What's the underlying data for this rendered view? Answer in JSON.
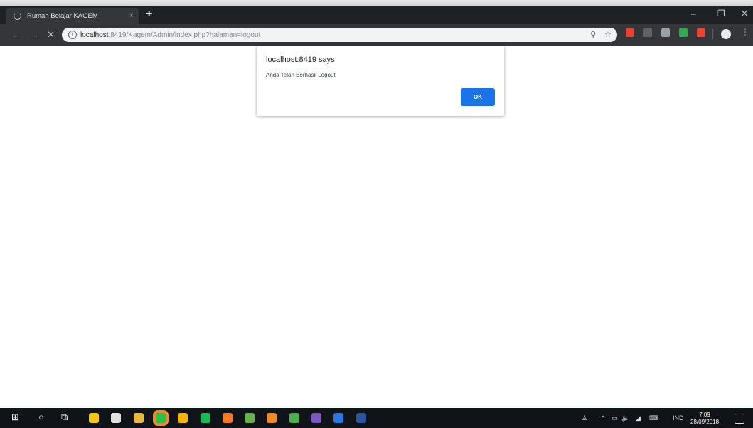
{
  "browser": {
    "tab": {
      "title": "Rumah Belajar KAGEM",
      "close_glyph": "×"
    },
    "new_tab_glyph": "+",
    "window_controls": {
      "minimize": "–",
      "restore": "❐",
      "close": "✕"
    },
    "nav": {
      "back": "←",
      "forward": "→",
      "stop": "✕"
    },
    "omnibox": {
      "info_glyph": "i",
      "host": "localhost",
      "rest": ":8419/Kagem/Admin/index.php?halaman=logout",
      "zoom_icon": "⚲",
      "star_icon": "☆"
    },
    "menu_glyph": "⋮",
    "extension_colors": [
      "#e8432f",
      "#5f6368",
      "#9aa0a6",
      "#34a853",
      "#ea4335"
    ]
  },
  "dialog": {
    "title": "localhost:8419 says",
    "message": "Anda Telah Berhasil Logout",
    "ok_label": "OK",
    "ok_color": "#1a73e8"
  },
  "taskbar": {
    "start_glyph": "⊞",
    "search_glyph": "○",
    "taskview_glyph": "⧉",
    "apps": [
      {
        "name": "store",
        "color": "#f2c811"
      },
      {
        "name": "mail",
        "color": "#e0e0e0"
      },
      {
        "name": "explorer",
        "color": "#e8b93a"
      },
      {
        "name": "line",
        "color": "#2bc04a"
      },
      {
        "name": "chrome",
        "color": "#f4b400"
      },
      {
        "name": "spotify",
        "color": "#1db954"
      },
      {
        "name": "xampp",
        "color": "#fb7a24"
      },
      {
        "name": "app-badge",
        "color": "#6ab04c"
      },
      {
        "name": "paint",
        "color": "#f08a24"
      },
      {
        "name": "app-green",
        "color": "#4caf50"
      },
      {
        "name": "visual-studio",
        "color": "#7e57c2"
      },
      {
        "name": "notepad",
        "color": "#2b78e4"
      },
      {
        "name": "word",
        "color": "#2b579a"
      }
    ],
    "tray": {
      "people_glyph": "♙",
      "chevron": "^",
      "battery_glyph": "▭",
      "volume_glyph": "🔈",
      "network_glyph": "◢",
      "keyboard_glyph": "⌨",
      "language": "IND"
    },
    "clock": {
      "time": "7:09",
      "date": "28/09/2018"
    }
  }
}
